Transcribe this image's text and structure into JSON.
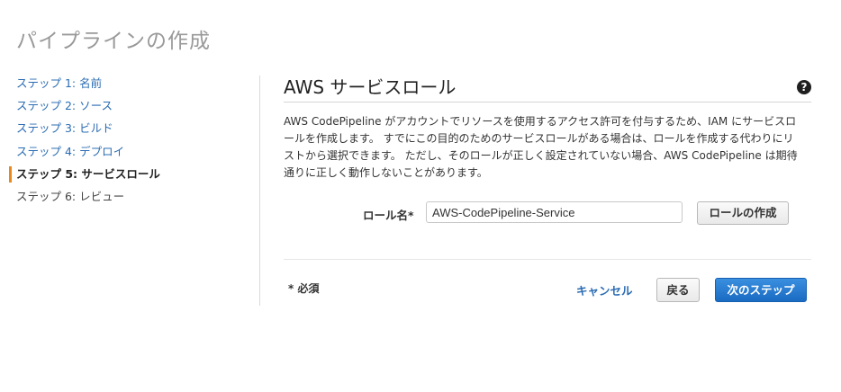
{
  "page": {
    "title": "パイプラインの作成"
  },
  "sidebar": {
    "steps": [
      {
        "label": "ステップ 1: 名前",
        "state": "link"
      },
      {
        "label": "ステップ 2: ソース",
        "state": "link"
      },
      {
        "label": "ステップ 3: ビルド",
        "state": "link"
      },
      {
        "label": "ステップ 4: デプロイ",
        "state": "link"
      },
      {
        "label": "ステップ 5: サービスロール",
        "state": "active"
      },
      {
        "label": "ステップ 6: レビュー",
        "state": "future"
      }
    ]
  },
  "section": {
    "title": "AWS サービスロール",
    "help_icon": "question-circle-icon",
    "description": "AWS CodePipeline がアカウントでリソースを使用するアクセス許可を付与するため、IAM にサービスロールを作成します。 すでにこの目的のためのサービスロールがある場合は、ロールを作成する代わりにリストから選択できます。 ただし、そのロールが正しく設定されていない場合、AWS CodePipeline は期待通りに正しく動作しないことがあります。"
  },
  "role_form": {
    "label": "ロール名*",
    "value": "AWS-CodePipeline-Service",
    "create_button": "ロールの作成"
  },
  "footer": {
    "required_note": "* 必須",
    "cancel": "キャンセル",
    "back": "戻る",
    "next": "次のステップ"
  },
  "colors": {
    "link": "#2b6cb3",
    "active_marker": "#e8891d",
    "primary_button": "#1a6bc2"
  }
}
